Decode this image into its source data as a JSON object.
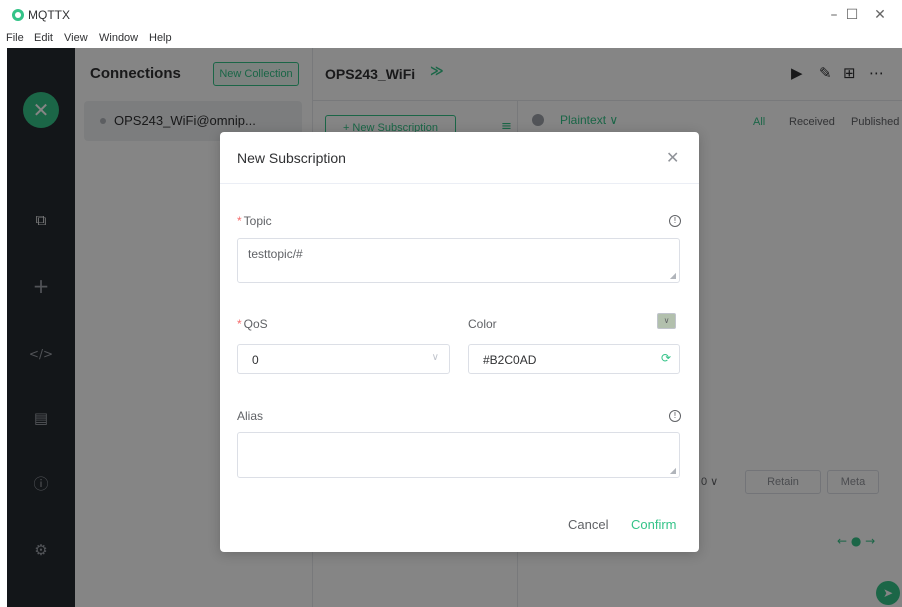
{
  "app": {
    "title": "MQTTX"
  },
  "menu": [
    "File",
    "Edit",
    "View",
    "Window",
    "Help"
  ],
  "window_controls": {
    "minimize": "–",
    "maximize": "☐",
    "close": "✕"
  },
  "sidebar_icons": [
    "connections-icon",
    "plus-icon",
    "code-icon",
    "log-icon",
    "info-icon",
    "settings-icon"
  ],
  "connections": {
    "title": "Connections",
    "new_collection": "New Collection",
    "items": [
      {
        "name": "OPS243_WiFi@omnip..."
      }
    ]
  },
  "main": {
    "title": "OPS243_WiFi",
    "new_subscription": "+ New Subscription",
    "payload_type": "Plaintext ∨",
    "filters": [
      "All",
      "Received",
      "Published"
    ],
    "qos_small": "0 ∨",
    "retain": "Retain",
    "meta": "Meta"
  },
  "modal": {
    "title": "New Subscription",
    "topic_label": "Topic",
    "topic_value": "testtopic/#",
    "qos_label": "QoS",
    "qos_value": "0",
    "color_label": "Color",
    "color_value": "#B2C0AD",
    "alias_label": "Alias",
    "alias_value": "",
    "required_mark": "*",
    "cancel": "Cancel",
    "confirm": "Confirm"
  },
  "colors": {
    "accent": "#34c388",
    "swatch": "#B2C0AD",
    "nav_bg": "#262b31"
  }
}
